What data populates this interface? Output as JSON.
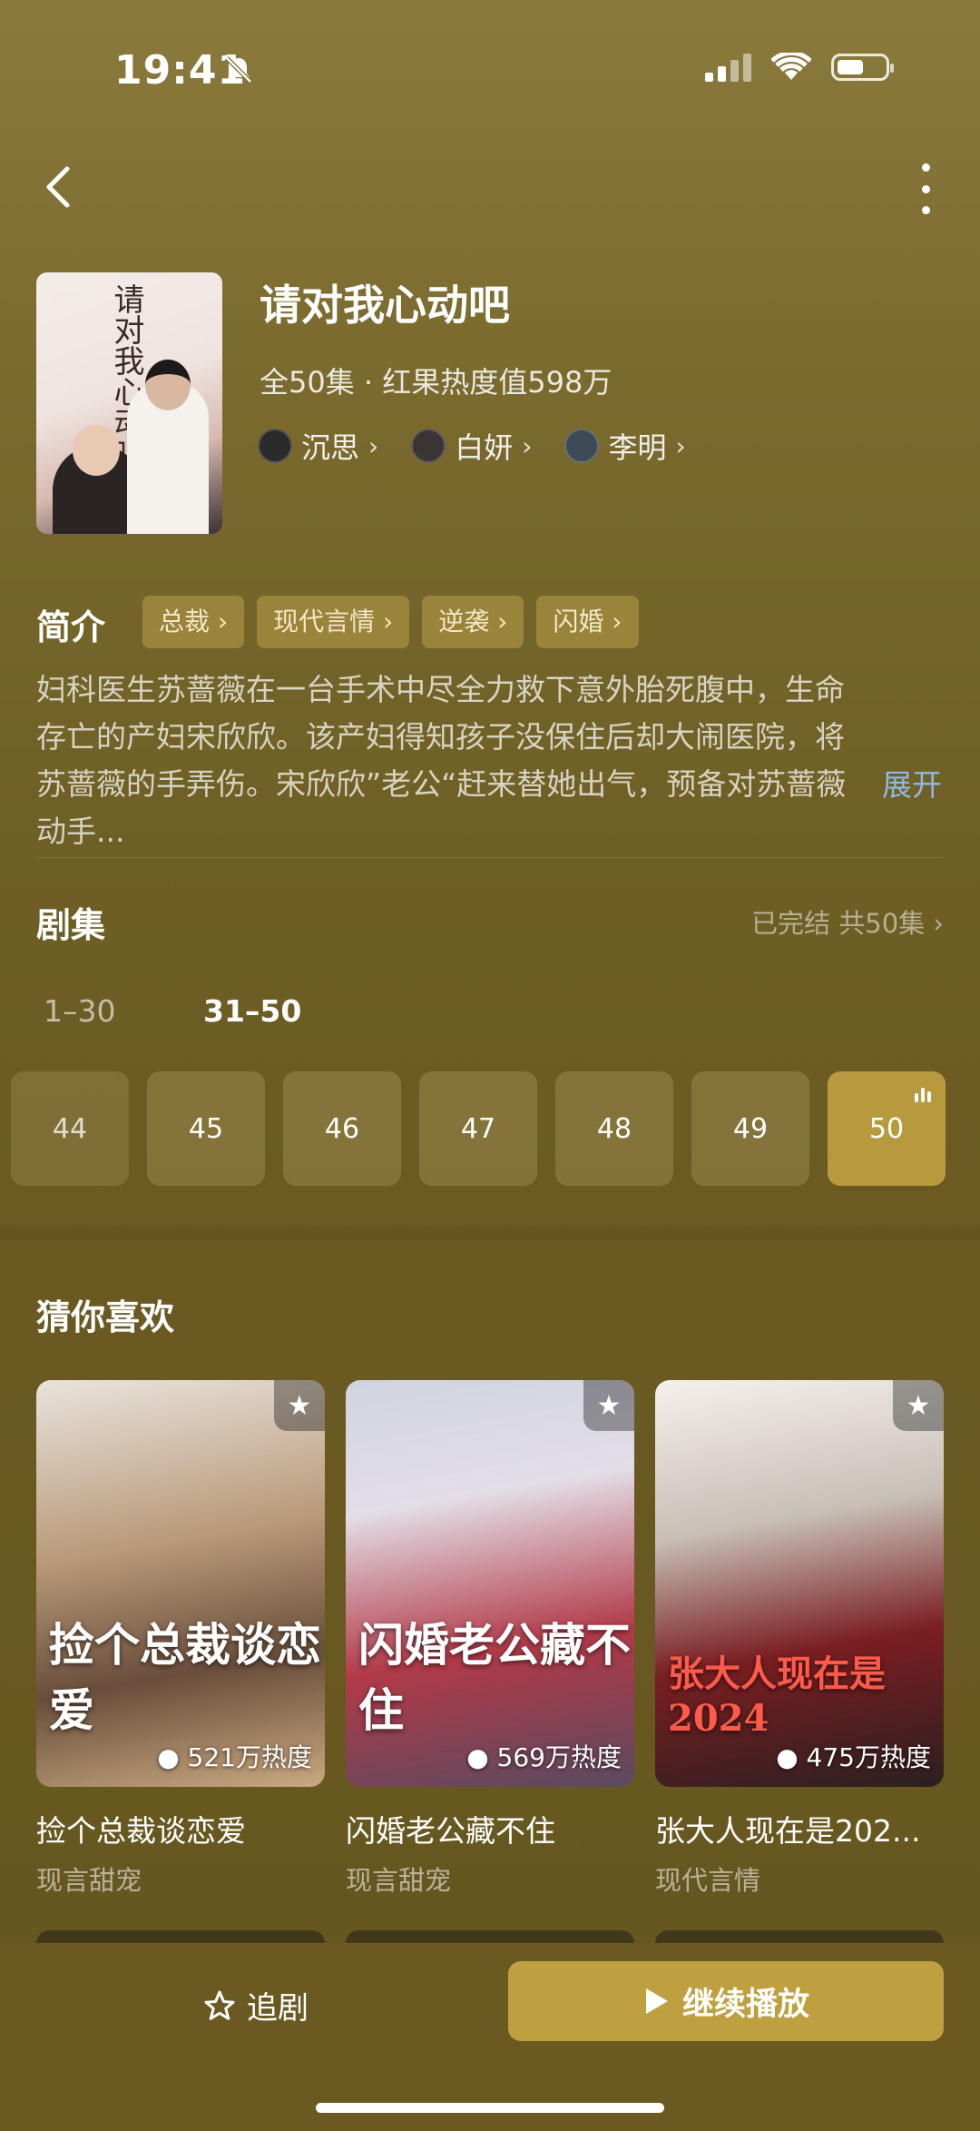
{
  "status": {
    "time": "19:41"
  },
  "drama": {
    "title": "请对我心动吧",
    "meta": "全50集 · 红果热度值598万",
    "poster_title": "请对我心动吧!",
    "actors": [
      "沉思",
      "白妍",
      "李明"
    ]
  },
  "intro": {
    "heading": "简介",
    "tags": [
      "总裁",
      "现代言情",
      "逆袭",
      "闪婚"
    ],
    "text": "妇科医生苏蔷薇在一台手术中尽全力救下意外胎死腹中，生命存亡的产妇宋欣欣。该产妇得知孩子没保住后却大闹医院，将苏蔷薇的手弄伤。宋欣欣”老公“赶来替她出气，预备对苏蔷薇动手...",
    "expand": "展开"
  },
  "episodes": {
    "heading": "剧集",
    "status": "已完结 共50集",
    "ranges": [
      "1–30",
      "31–50"
    ],
    "visible": [
      "44",
      "45",
      "46",
      "47",
      "48",
      "49",
      "50"
    ],
    "current": "50"
  },
  "recommend": {
    "heading": "猜你喜欢",
    "items": [
      {
        "title": "捡个总裁谈恋爱",
        "genre": "现言甜宠",
        "heat": "521万热度",
        "cover_text": "捡个总裁谈恋爱"
      },
      {
        "title": "闪婚老公藏不住",
        "genre": "现言甜宠",
        "heat": "569万热度",
        "cover_text": "闪婚老公藏不住"
      },
      {
        "title": "张大人现在是202...",
        "genre": "现代言情",
        "heat": "475万热度",
        "cover_text": "张大人现在是2024"
      }
    ]
  },
  "bottom": {
    "follow": "追剧",
    "play": "继续播放"
  },
  "colors": {
    "accent": "#bfa040",
    "link": "#8fb8e6",
    "background": "#6e5f25"
  }
}
